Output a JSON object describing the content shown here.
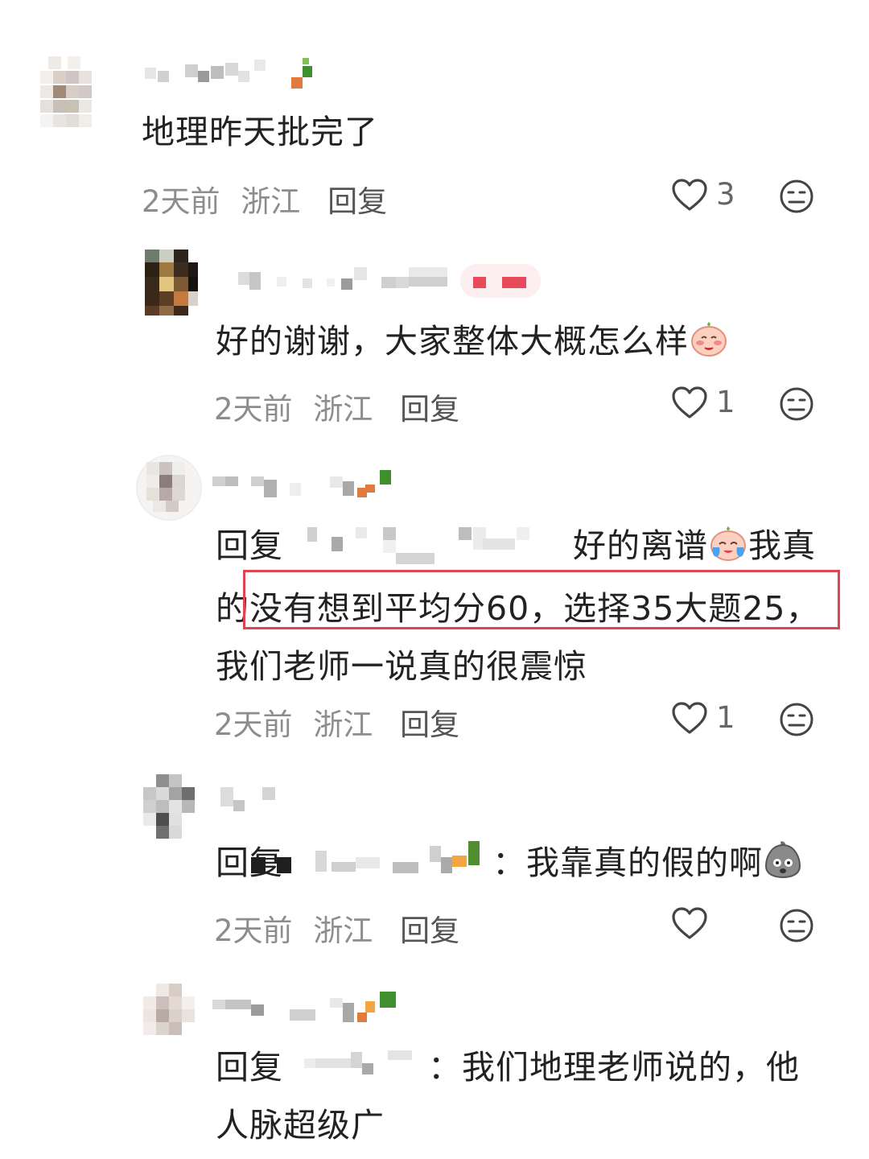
{
  "comments": [
    {
      "text": "地理昨天批完了",
      "date": "2天前",
      "location": "浙江",
      "reply_label": "回复",
      "likes": "3"
    },
    {
      "text_before_emoji": "好的谢谢，大家整体大概怎么样",
      "emoji": "shy-face-emoji",
      "date": "2天前",
      "location": "浙江",
      "reply_label": "回复",
      "likes": "1"
    },
    {
      "reply_prefix": "回复",
      "text_line1_after": "好的离谱",
      "emoji": "crying-face-emoji",
      "text_line1_tail": "我真",
      "text_line2_head": "的",
      "text_line2_highlight": "没有想到平均分60，选择35大题25，",
      "text_line3": "我们老师一说真的很震惊",
      "date": "2天前",
      "location": "浙江",
      "reply_label": "回复",
      "likes": "1"
    },
    {
      "reply_prefix": "回复",
      "colon": "：",
      "text": "我靠真的假的啊",
      "emoji": "shocked-face-emoji",
      "date": "2天前",
      "location": "浙江",
      "reply_label": "回复",
      "likes": ""
    },
    {
      "reply_prefix": "回复",
      "colon": "：",
      "text_line1": "我们地理老师说的，他",
      "text_line2": "人脉超级广"
    }
  ],
  "colors": {
    "highlight_border": "#e04450",
    "meta_text": "#8d8d8d",
    "body_text": "#222222"
  }
}
